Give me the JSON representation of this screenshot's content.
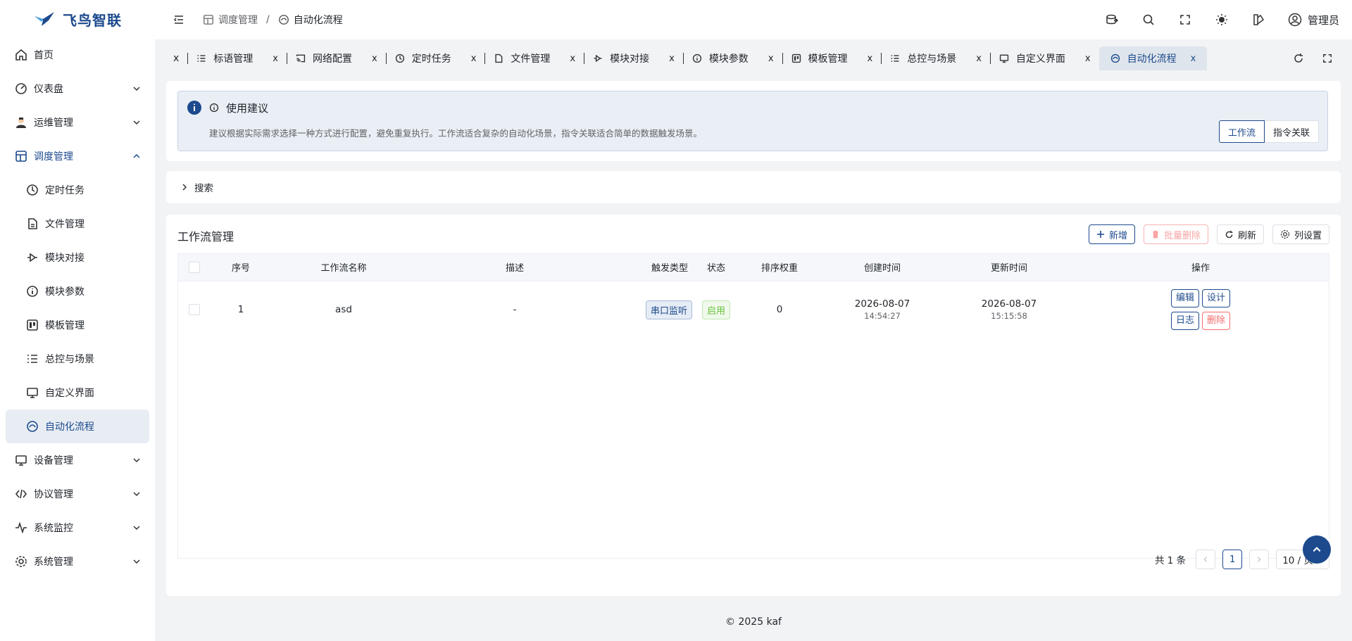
{
  "brand": {
    "name": "飞鸟智联"
  },
  "sidebar": {
    "items": [
      {
        "label": "首页"
      },
      {
        "label": "仪表盘"
      },
      {
        "label": "运维管理"
      },
      {
        "label": "调度管理"
      },
      {
        "label": "设备管理"
      },
      {
        "label": "协议管理"
      },
      {
        "label": "系统监控"
      },
      {
        "label": "系统管理"
      }
    ],
    "sub": [
      {
        "label": "定时任务"
      },
      {
        "label": "文件管理"
      },
      {
        "label": "模块对接"
      },
      {
        "label": "模块参数"
      },
      {
        "label": "模板管理"
      },
      {
        "label": "总控与场景"
      },
      {
        "label": "自定义界面"
      },
      {
        "label": "自动化流程"
      }
    ]
  },
  "header": {
    "breadcrumb": [
      "调度管理",
      "/",
      "自动化流程"
    ],
    "user": "管理员"
  },
  "tabs": {
    "partial_close": "x",
    "close": "x",
    "items": [
      {
        "label": "标语管理"
      },
      {
        "label": "网络配置"
      },
      {
        "label": "定时任务"
      },
      {
        "label": "文件管理"
      },
      {
        "label": "模块对接"
      },
      {
        "label": "模块参数"
      },
      {
        "label": "模板管理"
      },
      {
        "label": "总控与场景"
      },
      {
        "label": "自定义界面"
      },
      {
        "label": "自动化流程"
      }
    ]
  },
  "notice": {
    "title": "使用建议",
    "desc": "建议根据实际需求选择一种方式进行配置，避免重复执行。工作流适合复杂的自动化场景，指令关联适合简单的数据触发场景。",
    "options": [
      "工作流",
      "指令关联"
    ]
  },
  "search": {
    "label": "搜索"
  },
  "panel": {
    "title": "工作流管理",
    "buttons": {
      "add": "新增",
      "batch_delete": "批量删除",
      "refresh": "刷新",
      "columns": "列设置"
    }
  },
  "table": {
    "headers": [
      "序号",
      "工作流名称",
      "描述",
      "触发类型",
      "状态",
      "排序权重",
      "创建时间",
      "更新时间",
      "操作"
    ],
    "rows": [
      {
        "index": "1",
        "name": "asd",
        "desc": "-",
        "trigger": "串口监听",
        "status": "启用",
        "weight": "0",
        "created_date": "2026-08-07",
        "created_time": "14:54:27",
        "updated_date": "2026-08-07",
        "updated_time": "15:15:58",
        "actions": {
          "edit": "编辑",
          "design": "设计",
          "log": "日志",
          "delete": "删除"
        }
      }
    ]
  },
  "pagination": {
    "total": "共 1 条",
    "current": "1",
    "page_size": "10 / 页"
  },
  "footer": "© 2025 kaf",
  "colors": {
    "primary": "#1c4a8d",
    "danger": "#f56c6c",
    "success": "#67c23a"
  }
}
